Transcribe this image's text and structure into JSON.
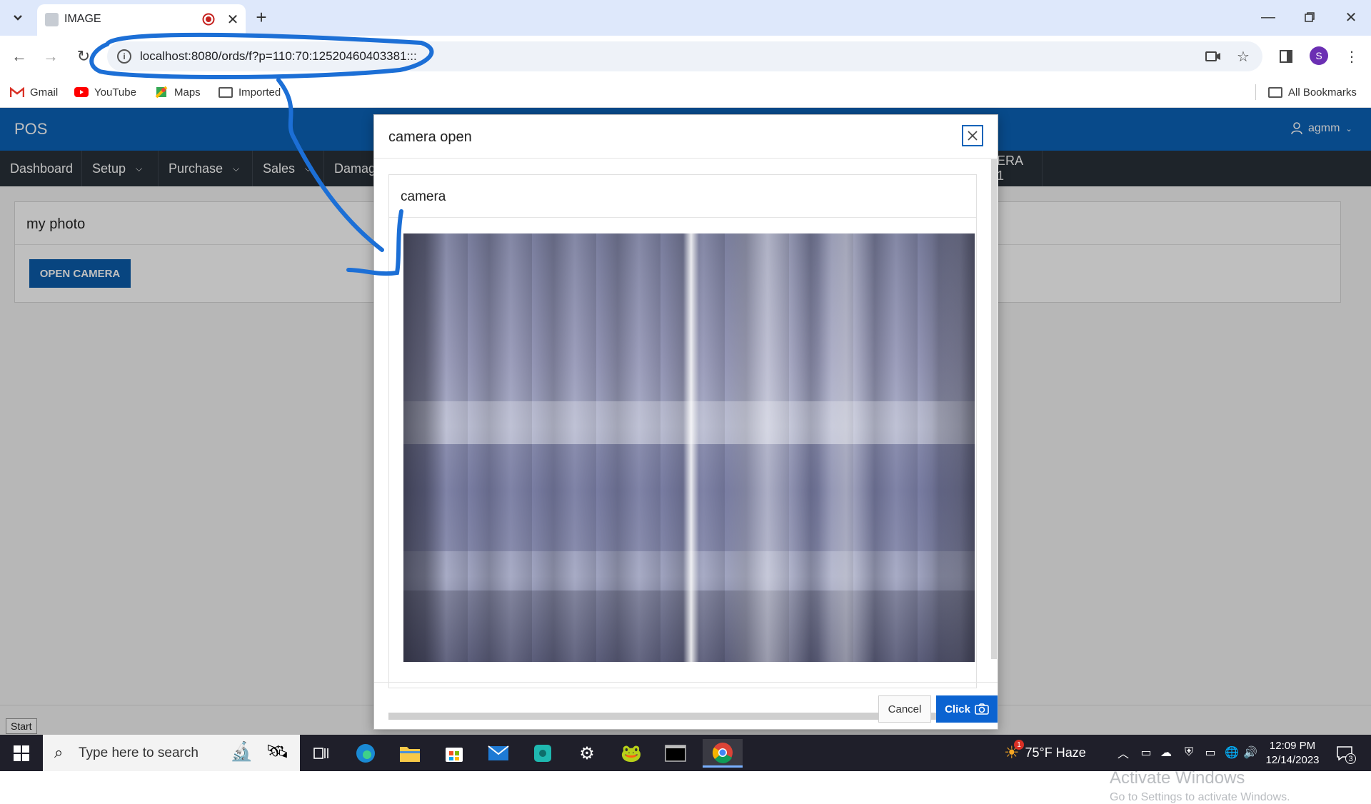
{
  "browser": {
    "tab_title": "IMAGE",
    "url": "localhost:8080/ords/f?p=110:70:12520460403381:::",
    "bookmarks": [
      {
        "label": "Gmail",
        "icon": "gmail-icon"
      },
      {
        "label": "YouTube",
        "icon": "youtube-icon"
      },
      {
        "label": "Maps",
        "icon": "maps-icon"
      },
      {
        "label": "Imported",
        "icon": "folder-icon"
      }
    ],
    "all_bookmarks": "All Bookmarks",
    "profile_initial": "S"
  },
  "app": {
    "title": "POS",
    "user": "agmm",
    "nav": [
      {
        "label": "Dashboard",
        "has_menu": false
      },
      {
        "label": "Setup",
        "has_menu": true
      },
      {
        "label": "Purchase",
        "has_menu": true
      },
      {
        "label": "Sales",
        "has_menu": true
      },
      {
        "label": "Damag",
        "has_menu": false
      },
      {
        "label": "ERA 1",
        "has_menu": false
      }
    ],
    "region_title": "my photo",
    "open_camera_label": "OPEN CAMERA",
    "tooltip": "Start"
  },
  "dialog": {
    "title": "camera open",
    "region_title": "camera",
    "cancel_label": "Cancel",
    "click_label": "Click"
  },
  "watermark": {
    "line1": "Activate Windows",
    "line2": "Go to Settings to activate Windows."
  },
  "taskbar": {
    "search_placeholder": "Type here to search",
    "weather": "75°F  Haze",
    "weather_badge": "1",
    "time": "12:09 PM",
    "date": "12/14/2023",
    "notification_count": "3"
  },
  "colors": {
    "app_header": "#0b63b9",
    "app_nav": "#283038",
    "primary_button": "#0b5cab",
    "annotation": "#1c6fd6"
  }
}
